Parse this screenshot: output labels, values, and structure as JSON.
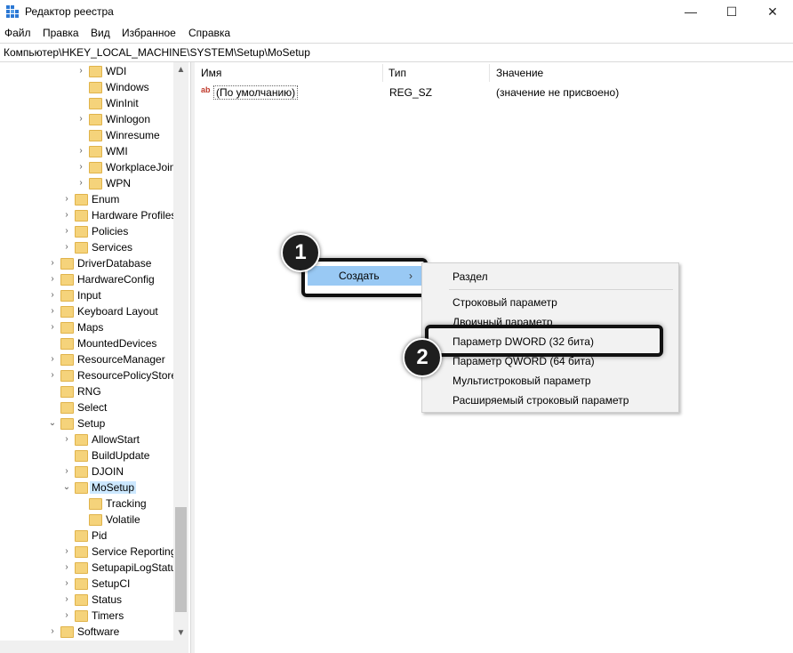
{
  "window": {
    "title": "Редактор реестра",
    "controls": {
      "minimize": "—",
      "maximize": "☐",
      "close": "✕"
    }
  },
  "menubar": [
    "Файл",
    "Правка",
    "Вид",
    "Избранное",
    "Справка"
  ],
  "address": "Компьютер\\HKEY_LOCAL_MACHINE\\SYSTEM\\Setup\\MoSetup",
  "tree": [
    {
      "label": "WDI",
      "chevron": "›",
      "level": 3
    },
    {
      "label": "Windows",
      "chevron": "",
      "level": 3
    },
    {
      "label": "WinInit",
      "chevron": "",
      "level": 3
    },
    {
      "label": "Winlogon",
      "chevron": "›",
      "level": 3
    },
    {
      "label": "Winresume",
      "chevron": "",
      "level": 3
    },
    {
      "label": "WMI",
      "chevron": "›",
      "level": 3
    },
    {
      "label": "WorkplaceJoin",
      "chevron": "›",
      "level": 3
    },
    {
      "label": "WPN",
      "chevron": "›",
      "level": 3
    },
    {
      "label": "Enum",
      "chevron": "›",
      "level": 2
    },
    {
      "label": "Hardware Profiles",
      "chevron": "›",
      "level": 2
    },
    {
      "label": "Policies",
      "chevron": "›",
      "level": 2
    },
    {
      "label": "Services",
      "chevron": "›",
      "level": 2
    },
    {
      "label": "DriverDatabase",
      "chevron": "›",
      "level": 1
    },
    {
      "label": "HardwareConfig",
      "chevron": "›",
      "level": 1
    },
    {
      "label": "Input",
      "chevron": "›",
      "level": 1
    },
    {
      "label": "Keyboard Layout",
      "chevron": "›",
      "level": 1
    },
    {
      "label": "Maps",
      "chevron": "›",
      "level": 1
    },
    {
      "label": "MountedDevices",
      "chevron": "",
      "level": 1
    },
    {
      "label": "ResourceManager",
      "chevron": "›",
      "level": 1
    },
    {
      "label": "ResourcePolicyStore",
      "chevron": "›",
      "level": 1
    },
    {
      "label": "RNG",
      "chevron": "",
      "level": 1
    },
    {
      "label": "Select",
      "chevron": "",
      "level": 1
    },
    {
      "label": "Setup",
      "chevron": "⌄",
      "level": 1
    },
    {
      "label": "AllowStart",
      "chevron": "›",
      "level": 2
    },
    {
      "label": "BuildUpdate",
      "chevron": "",
      "level": 2
    },
    {
      "label": "DJOIN",
      "chevron": "›",
      "level": 2
    },
    {
      "label": "MoSetup",
      "chevron": "⌄",
      "level": 2,
      "selected": true
    },
    {
      "label": "Tracking",
      "chevron": "",
      "level": 3
    },
    {
      "label": "Volatile",
      "chevron": "",
      "level": 3
    },
    {
      "label": "Pid",
      "chevron": "",
      "level": 2
    },
    {
      "label": "Service Reporting",
      "chevron": "›",
      "level": 2
    },
    {
      "label": "SetupapiLogStatus",
      "chevron": "›",
      "level": 2
    },
    {
      "label": "SetupCI",
      "chevron": "›",
      "level": 2
    },
    {
      "label": "Status",
      "chevron": "›",
      "level": 2
    },
    {
      "label": "Timers",
      "chevron": "›",
      "level": 2
    },
    {
      "label": "Software",
      "chevron": "›",
      "level": 1
    }
  ],
  "list": {
    "headers": {
      "name": "Имя",
      "type": "Тип",
      "value": "Значение"
    },
    "rows": [
      {
        "icon": "ab",
        "name": "(По умолчанию)",
        "type": "REG_SZ",
        "value": "(значение не присвоено)"
      }
    ]
  },
  "context_menu": {
    "create_label": "Создать",
    "create_arrow": "›"
  },
  "submenu": {
    "items": [
      "Раздел",
      "Строковый параметр",
      "Двоичный параметр",
      "Параметр DWORD (32 бита)",
      "Параметр QWORD (64 бита)",
      "Мультистроковый параметр",
      "Расширяемый строковый параметр"
    ]
  },
  "badges": [
    "1",
    "2"
  ],
  "scroll_icons": {
    "up": "▲",
    "down": "▼"
  }
}
